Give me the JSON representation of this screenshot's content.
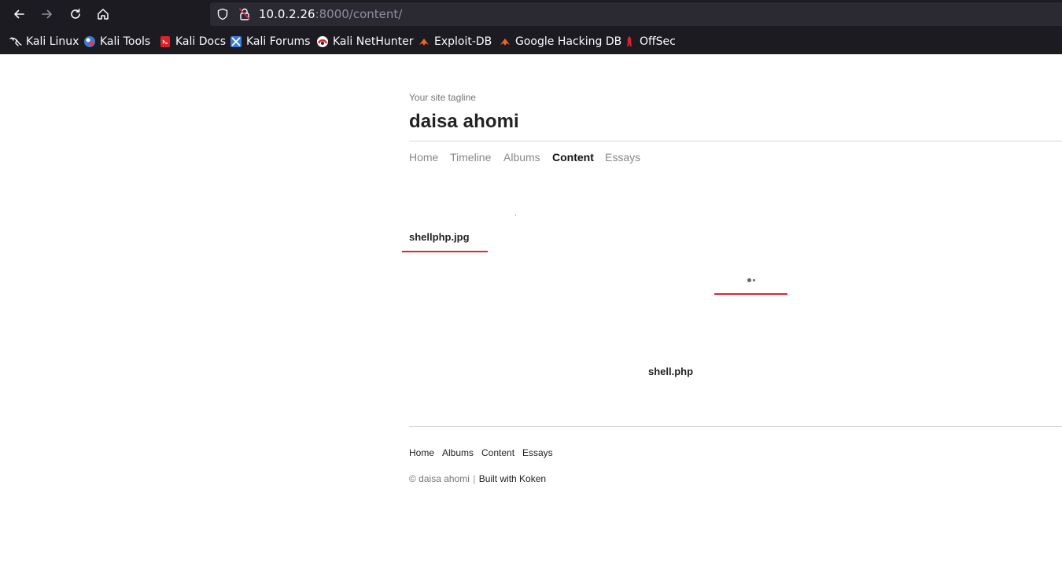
{
  "browser": {
    "url_host": "10.0.2.26",
    "url_rest": ":8000/content/",
    "bookmarks": [
      {
        "label": "Kali Linux",
        "icon": "kali-dragon-icon"
      },
      {
        "label": "Kali Tools",
        "icon": "kali-tools-icon"
      },
      {
        "label": "Kali Docs",
        "icon": "kali-docs-icon"
      },
      {
        "label": "Kali Forums",
        "icon": "kali-forums-icon"
      },
      {
        "label": "Kali NetHunter",
        "icon": "kali-nethunter-icon"
      },
      {
        "label": "Exploit-DB",
        "icon": "exploit-db-icon"
      },
      {
        "label": "Google Hacking DB",
        "icon": "ghdb-icon"
      },
      {
        "label": "OffSec",
        "icon": "offsec-icon"
      }
    ]
  },
  "site": {
    "tagline": "Your site tagline",
    "title": "daisa ahomi",
    "nav": [
      {
        "label": "Home",
        "active": false
      },
      {
        "label": "Timeline",
        "active": false
      },
      {
        "label": "Albums",
        "active": false
      },
      {
        "label": "Content",
        "active": true
      },
      {
        "label": "Essays",
        "active": false
      }
    ]
  },
  "content": {
    "items": [
      {
        "title": "shellphp.jpg"
      },
      {
        "title": "shell.php"
      }
    ]
  },
  "footer": {
    "nav": [
      "Home",
      "Albums",
      "Content",
      "Essays"
    ],
    "copyright": "© daisa ahomi",
    "separator": "|",
    "built_with": "Built with Koken"
  },
  "colors": {
    "chrome_bg": "#1c1b22",
    "urlbar_bg": "#2b2a33",
    "accent_underline": "#e0252b"
  }
}
